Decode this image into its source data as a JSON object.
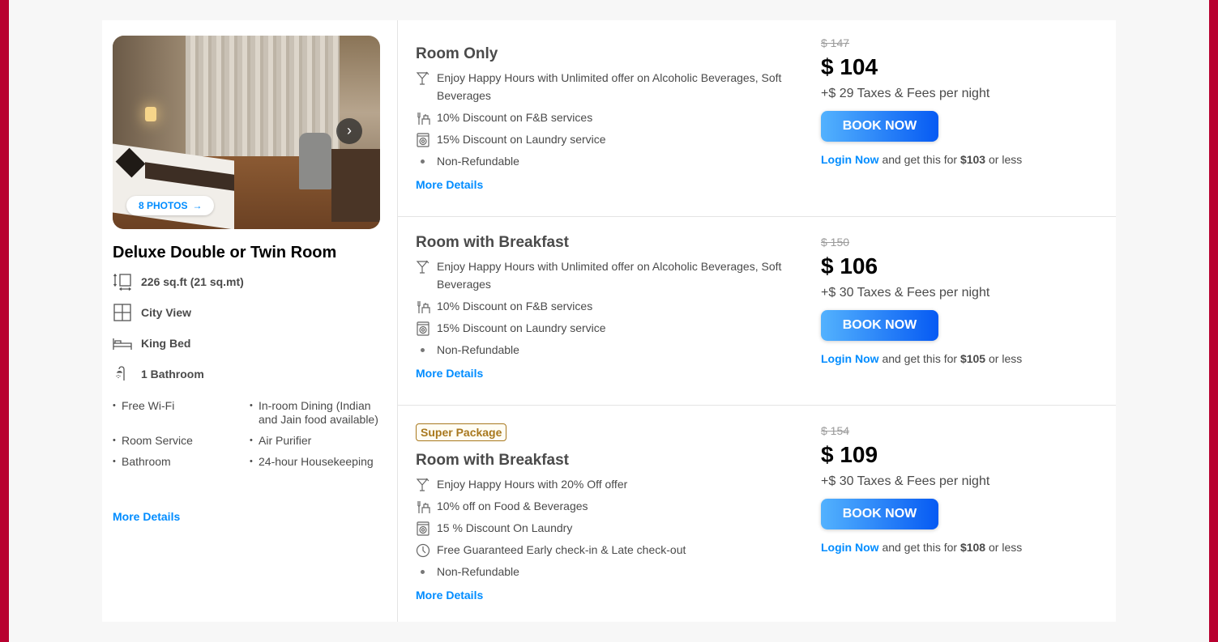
{
  "room": {
    "photos_label": "8 PHOTOS",
    "title": "Deluxe Double or Twin Room",
    "features": [
      {
        "icon": "area-icon",
        "label": "226 sq.ft (21 sq.mt)"
      },
      {
        "icon": "window-icon",
        "label": "City View"
      },
      {
        "icon": "bed-icon",
        "label": "King Bed"
      },
      {
        "icon": "shower-icon",
        "label": "1 Bathroom"
      }
    ],
    "amenities": [
      "Free Wi-Fi",
      "In-room Dining (Indian and Jain food available)",
      "Room Service",
      "Air Purifier",
      "Bathroom",
      "24-hour Housekeeping"
    ],
    "more_details": "More Details"
  },
  "plans": [
    {
      "badge": "",
      "name": "Room Only",
      "inclusions": [
        {
          "icon": "cocktail-icon",
          "text": "Enjoy Happy Hours with Unlimited offer on Alcoholic Beverages, Soft Beverages"
        },
        {
          "icon": "dining-icon",
          "text": "10% Discount on F&B services"
        },
        {
          "icon": "laundry-icon",
          "text": "15% Discount on Laundry service"
        },
        {
          "icon": "bullet",
          "text": "Non-Refundable"
        }
      ],
      "more_details": "More Details",
      "old_price": "$ 147",
      "price": "$ 104",
      "taxes": "+$ 29 Taxes & Fees per night",
      "book_label": "BOOK NOW",
      "login_link": "Login Now",
      "login_text": "and get this for",
      "login_price": "$103",
      "login_suffix": "or less"
    },
    {
      "badge": "",
      "name": "Room with Breakfast",
      "inclusions": [
        {
          "icon": "cocktail-icon",
          "text": "Enjoy Happy Hours with Unlimited offer on Alcoholic Beverages, Soft Beverages"
        },
        {
          "icon": "dining-icon",
          "text": "10% Discount on F&B services"
        },
        {
          "icon": "laundry-icon",
          "text": "15% Discount on Laundry service"
        },
        {
          "icon": "bullet",
          "text": "Non-Refundable"
        }
      ],
      "more_details": "More Details",
      "old_price": "$ 150",
      "price": "$ 106",
      "taxes": "+$ 30 Taxes & Fees per night",
      "book_label": "BOOK NOW",
      "login_link": "Login Now",
      "login_text": "and get this for",
      "login_price": "$105",
      "login_suffix": "or less"
    },
    {
      "badge": "Super Package",
      "name": "Room with Breakfast",
      "inclusions": [
        {
          "icon": "cocktail-icon",
          "text": "Enjoy Happy Hours with 20% Off offer"
        },
        {
          "icon": "dining-icon",
          "text": "10% off on Food & Beverages"
        },
        {
          "icon": "laundry-icon",
          "text": "15 % Discount On Laundry"
        },
        {
          "icon": "clock-icon",
          "text": "Free Guaranteed Early check-in & Late check-out"
        },
        {
          "icon": "bullet",
          "text": "Non-Refundable"
        }
      ],
      "more_details": "More Details",
      "old_price": "$ 154",
      "price": "$ 109",
      "taxes": "+$ 30 Taxes & Fees per night",
      "book_label": "BOOK NOW",
      "login_link": "Login Now",
      "login_text": "and get this for",
      "login_price": "$108",
      "login_suffix": "or less"
    }
  ]
}
